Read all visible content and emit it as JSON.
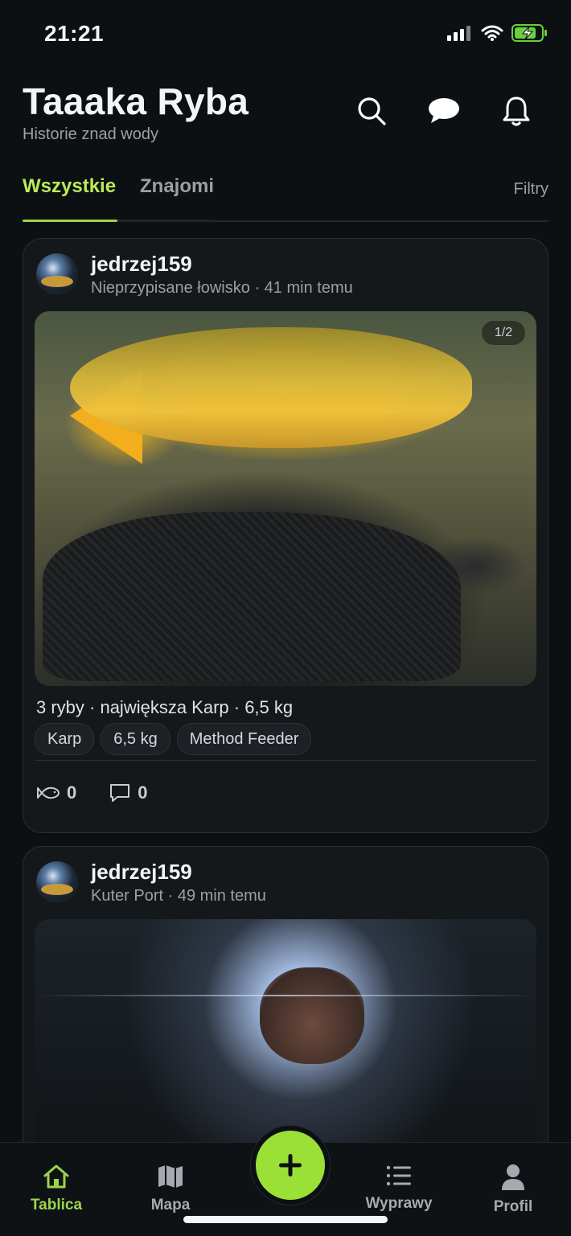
{
  "status_bar": {
    "time": "21:21"
  },
  "header": {
    "title": "Taaaka Ryba",
    "subtitle": "Historie znad wody",
    "actions": [
      "search-icon",
      "chat-bubble-icon",
      "bell-icon"
    ]
  },
  "tabs": {
    "all": "Wszystkie",
    "friends": "Znajomi",
    "filters": "Filtry"
  },
  "posts": [
    {
      "username": "jedrzej159",
      "location": "Nieprzypisane łowisko",
      "separator": "·",
      "time_ago": "41 min temu",
      "photo_counter": "1/2",
      "summary": "3 ryby · największa Karp · 6,5 kg",
      "chips": [
        "Karp",
        "6,5 kg",
        "Method Feeder"
      ],
      "likes": "0",
      "comments": "0"
    },
    {
      "username": "jedrzej159",
      "location": "Kuter Port",
      "separator": "·",
      "time_ago": "49 min temu"
    }
  ],
  "bottom_nav": {
    "home": "Tablica",
    "map": "Mapa",
    "trips": "Wyprawy",
    "profile": "Profil"
  },
  "colors": {
    "accent": "#9bd54b",
    "fab": "#9be037",
    "background": "#0d1012"
  }
}
